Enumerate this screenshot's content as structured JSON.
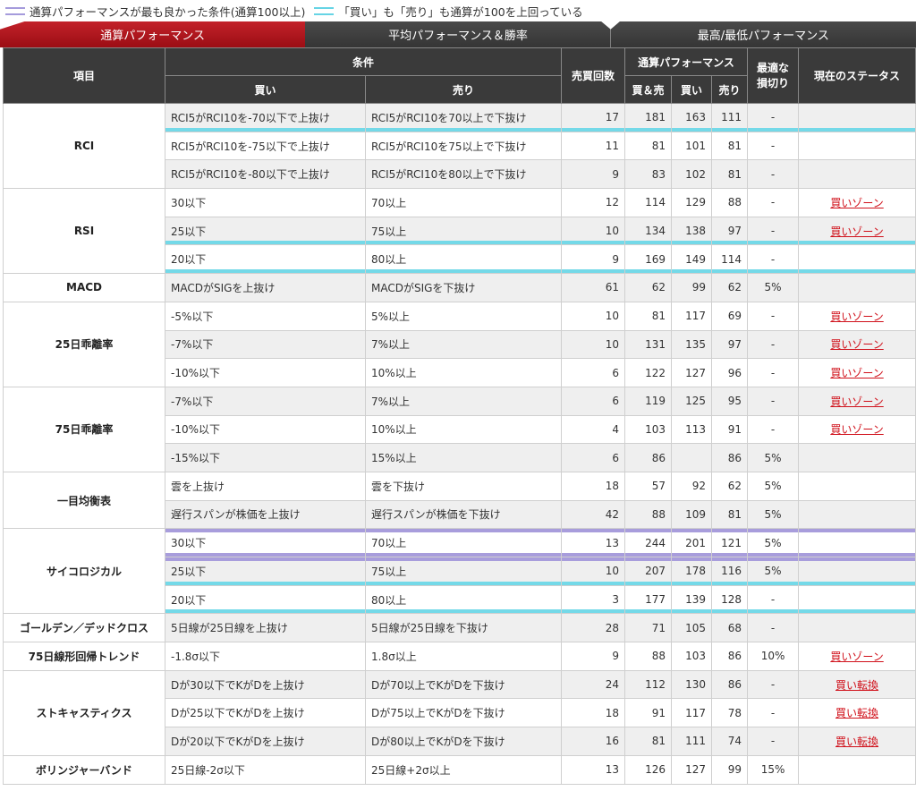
{
  "legend": {
    "item1": "通算パフォーマンスが最も良かった条件(通算100以上)",
    "item2": "「買い」も「売り」も通算が100を上回っている",
    "color_purple": "#a59bdc",
    "color_cyan": "#66d4e5"
  },
  "tabs": [
    {
      "label": "通算パフォーマンス",
      "active": true
    },
    {
      "label": "平均パフォーマンス＆勝率",
      "active": false
    },
    {
      "label": "最高/最低パフォーマンス",
      "active": false
    }
  ],
  "header": {
    "item": "項目",
    "conditions": "条件",
    "buy": "買い",
    "sell": "売り",
    "trades": "売買回数",
    "perf": "通算パフォーマンス",
    "perf_both": "買＆売",
    "perf_buy": "買い",
    "perf_sell": "売り",
    "stop_line1": "最適な",
    "stop_line2": "損切り",
    "status": "現在のステータス"
  },
  "rows": [
    {
      "item": "RCI",
      "buy": "RCI5がRCI10を-70以下で上抜け",
      "sell": "RCI5がRCI10を70以上で下抜け",
      "trades": "17",
      "both": "181",
      "pbuy": "163",
      "psell": "111",
      "stop": "-",
      "status": ""
    },
    {
      "item": "",
      "buy": "RCI5がRCI10を-75以下で上抜け",
      "sell": "RCI5がRCI10を75以上で下抜け",
      "trades": "11",
      "both": "81",
      "pbuy": "101",
      "psell": "81",
      "stop": "-",
      "status": ""
    },
    {
      "item": "",
      "buy": "RCI5がRCI10を-80以下で上抜け",
      "sell": "RCI5がRCI10を80以上で下抜け",
      "trades": "9",
      "both": "83",
      "pbuy": "102",
      "psell": "81",
      "stop": "-",
      "status": ""
    },
    {
      "item": "RSI",
      "buy": "30以下",
      "sell": "70以上",
      "trades": "12",
      "both": "114",
      "pbuy": "129",
      "psell": "88",
      "stop": "-",
      "status": "買いゾーン"
    },
    {
      "item": "",
      "buy": "25以下",
      "sell": "75以上",
      "trades": "10",
      "both": "134",
      "pbuy": "138",
      "psell": "97",
      "stop": "-",
      "status": "買いゾーン"
    },
    {
      "item": "",
      "buy": "20以下",
      "sell": "80以上",
      "trades": "9",
      "both": "169",
      "pbuy": "149",
      "psell": "114",
      "stop": "-",
      "status": ""
    },
    {
      "item": "MACD",
      "buy": "MACDがSIGを上抜け",
      "sell": "MACDがSIGを下抜け",
      "trades": "61",
      "both": "62",
      "pbuy": "99",
      "psell": "62",
      "stop": "5%",
      "status": ""
    },
    {
      "item": "25日乖離率",
      "buy": "-5%以下",
      "sell": "5%以上",
      "trades": "10",
      "both": "81",
      "pbuy": "117",
      "psell": "69",
      "stop": "-",
      "status": "買いゾーン"
    },
    {
      "item": "",
      "buy": "-7%以下",
      "sell": "7%以上",
      "trades": "10",
      "both": "131",
      "pbuy": "135",
      "psell": "97",
      "stop": "-",
      "status": "買いゾーン"
    },
    {
      "item": "",
      "buy": "-10%以下",
      "sell": "10%以上",
      "trades": "6",
      "both": "122",
      "pbuy": "127",
      "psell": "96",
      "stop": "-",
      "status": "買いゾーン"
    },
    {
      "item": "75日乖離率",
      "buy": "-7%以下",
      "sell": "7%以上",
      "trades": "6",
      "both": "119",
      "pbuy": "125",
      "psell": "95",
      "stop": "-",
      "status": "買いゾーン"
    },
    {
      "item": "",
      "buy": "-10%以下",
      "sell": "10%以上",
      "trades": "4",
      "both": "103",
      "pbuy": "113",
      "psell": "91",
      "stop": "-",
      "status": "買いゾーン"
    },
    {
      "item": "",
      "buy": "-15%以下",
      "sell": "15%以上",
      "trades": "6",
      "both": "86",
      "pbuy": "",
      "psell": "86",
      "stop": "5%",
      "status": ""
    },
    {
      "item": "一目均衡表",
      "buy": "雲を上抜け",
      "sell": "雲を下抜け",
      "trades": "18",
      "both": "57",
      "pbuy": "92",
      "psell": "62",
      "stop": "5%",
      "status": ""
    },
    {
      "item": "",
      "buy": "遅行スパンが株価を上抜け",
      "sell": "遅行スパンが株価を下抜け",
      "trades": "42",
      "both": "88",
      "pbuy": "109",
      "psell": "81",
      "stop": "5%",
      "status": ""
    },
    {
      "item": "サイコロジカル",
      "buy": "30以下",
      "sell": "70以上",
      "trades": "13",
      "both": "244",
      "pbuy": "201",
      "psell": "121",
      "stop": "5%",
      "status": ""
    },
    {
      "item": "",
      "buy": "25以下",
      "sell": "75以上",
      "trades": "10",
      "both": "207",
      "pbuy": "178",
      "psell": "116",
      "stop": "5%",
      "status": ""
    },
    {
      "item": "",
      "buy": "20以下",
      "sell": "80以上",
      "trades": "3",
      "both": "177",
      "pbuy": "139",
      "psell": "128",
      "stop": "-",
      "status": ""
    },
    {
      "item": "ゴールデン／デッドクロス",
      "buy": "5日線が25日線を上抜け",
      "sell": "5日線が25日線を下抜け",
      "trades": "28",
      "both": "71",
      "pbuy": "105",
      "psell": "68",
      "stop": "-",
      "status": ""
    },
    {
      "item": "75日線形回帰トレンド",
      "buy": "-1.8σ以下",
      "sell": "1.8σ以上",
      "trades": "9",
      "both": "88",
      "pbuy": "103",
      "psell": "86",
      "stop": "10%",
      "status": "買いゾーン"
    },
    {
      "item": "ストキャスティクス",
      "buy": "Dが30以下でKがDを上抜け",
      "sell": "Dが70以上でKがDを下抜け",
      "trades": "24",
      "both": "112",
      "pbuy": "130",
      "psell": "86",
      "stop": "-",
      "status": "買い転換"
    },
    {
      "item": "",
      "buy": "Dが25以下でKがDを上抜け",
      "sell": "Dが75以上でKがDを下抜け",
      "trades": "18",
      "both": "91",
      "pbuy": "117",
      "psell": "78",
      "stop": "-",
      "status": "買い転換"
    },
    {
      "item": "",
      "buy": "Dが20以下でKがDを上抜け",
      "sell": "Dが80以上でKがDを下抜け",
      "trades": "16",
      "both": "81",
      "pbuy": "111",
      "psell": "74",
      "stop": "-",
      "status": "買い転換"
    },
    {
      "item": "ボリンジャーバンド",
      "buy": "25日線-2σ以下",
      "sell": "25日線+2σ以上",
      "trades": "13",
      "both": "126",
      "pbuy": "127",
      "psell": "99",
      "stop": "15%",
      "status": ""
    }
  ]
}
